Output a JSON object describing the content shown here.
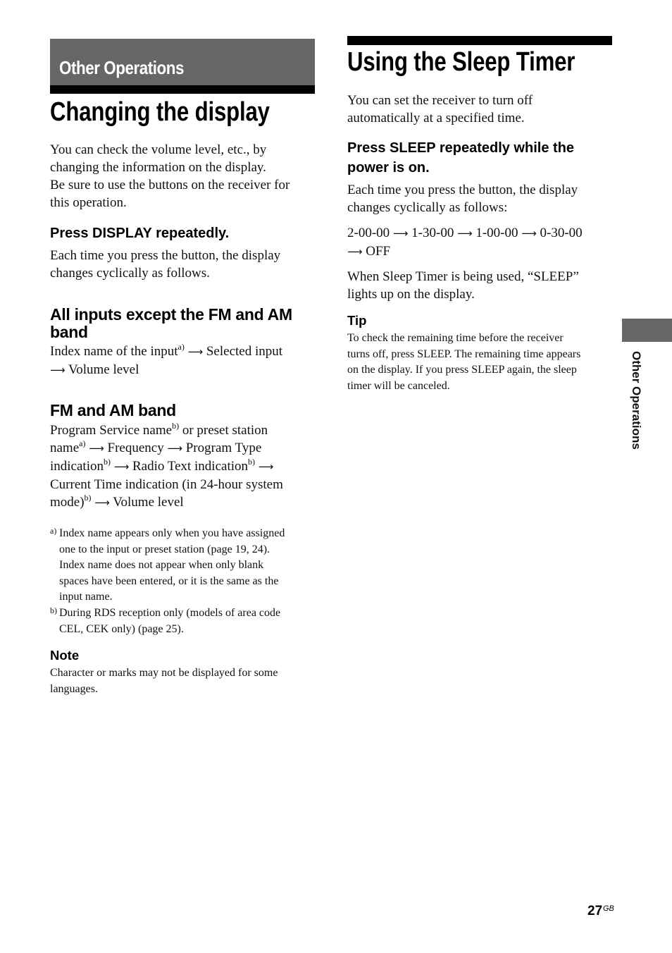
{
  "section_banner": "Other Operations",
  "left": {
    "title": "Changing the display",
    "intro_lines": [
      "You can check the volume level, etc., by",
      "changing the information on the display.",
      "Be sure to use the buttons on the receiver for",
      "this operation."
    ],
    "step": "Press DISPLAY repeatedly.",
    "step_desc_lines": [
      "Each time you press the button, the display",
      "changes cyclically as follows."
    ],
    "all_inputs": {
      "heading_lines": [
        "All inputs except the FM and AM",
        "band"
      ],
      "seq": {
        "a": "Index name of the input",
        "a_sup": "a)",
        "b": "Selected input",
        "c": "Volume level"
      }
    },
    "fm_am": {
      "heading": "FM and AM band",
      "seq": {
        "t1": "Program Service name",
        "t1_sup": "b)",
        "t2": " or preset station",
        "t3": "name",
        "t3_sup": "a)",
        "t4": "Frequency",
        "t5": "Program Type",
        "t6": "indication",
        "t6_sup": "b)",
        "t7": "Radio Text indication",
        "t7_sup": "b)",
        "t8": "Current Time indication (in 24-hour system",
        "t9": "mode)",
        "t9_sup": "b)",
        "t10": "Volume level"
      }
    },
    "footnotes": [
      {
        "mark": "a)",
        "lines": [
          "Index name appears only when you have assigned",
          "one to the input or preset station (page 19, 24).",
          "Index name does not appear when only blank",
          "spaces have been entered, or it is the same as the",
          "input name."
        ]
      },
      {
        "mark": "b)",
        "lines": [
          "During RDS reception only (models of area code",
          "CEL, CEK only) (page 25)."
        ]
      }
    ],
    "note_heading": "Note",
    "note_lines": [
      "Character or marks may not be displayed for some",
      "languages."
    ]
  },
  "right": {
    "title": "Using the Sleep Timer",
    "intro_lines": [
      "You can set the receiver to turn off",
      "automatically at a specified time."
    ],
    "step_lines": [
      "Press SLEEP repeatedly while the",
      "power is on."
    ],
    "step_desc_lines": [
      "Each time you press the button, the display",
      "changes cyclically as follows:"
    ],
    "sequence": [
      "2-00-00",
      "1-30-00",
      "1-00-00",
      "0-30-00",
      "OFF"
    ],
    "sleep_note_lines": [
      "When Sleep Timer is being used, “SLEEP”",
      "lights up on the display."
    ],
    "tip_heading": "Tip",
    "tip_lines": [
      "To check the remaining time before the receiver",
      "turns off, press SLEEP. The remaining time appears",
      "on the display. If you press SLEEP again, the sleep",
      "timer will be canceled."
    ]
  },
  "arrow_glyph": "⟶",
  "side_tab_label": "Other Operations",
  "page_number": "27",
  "page_suffix": "GB"
}
